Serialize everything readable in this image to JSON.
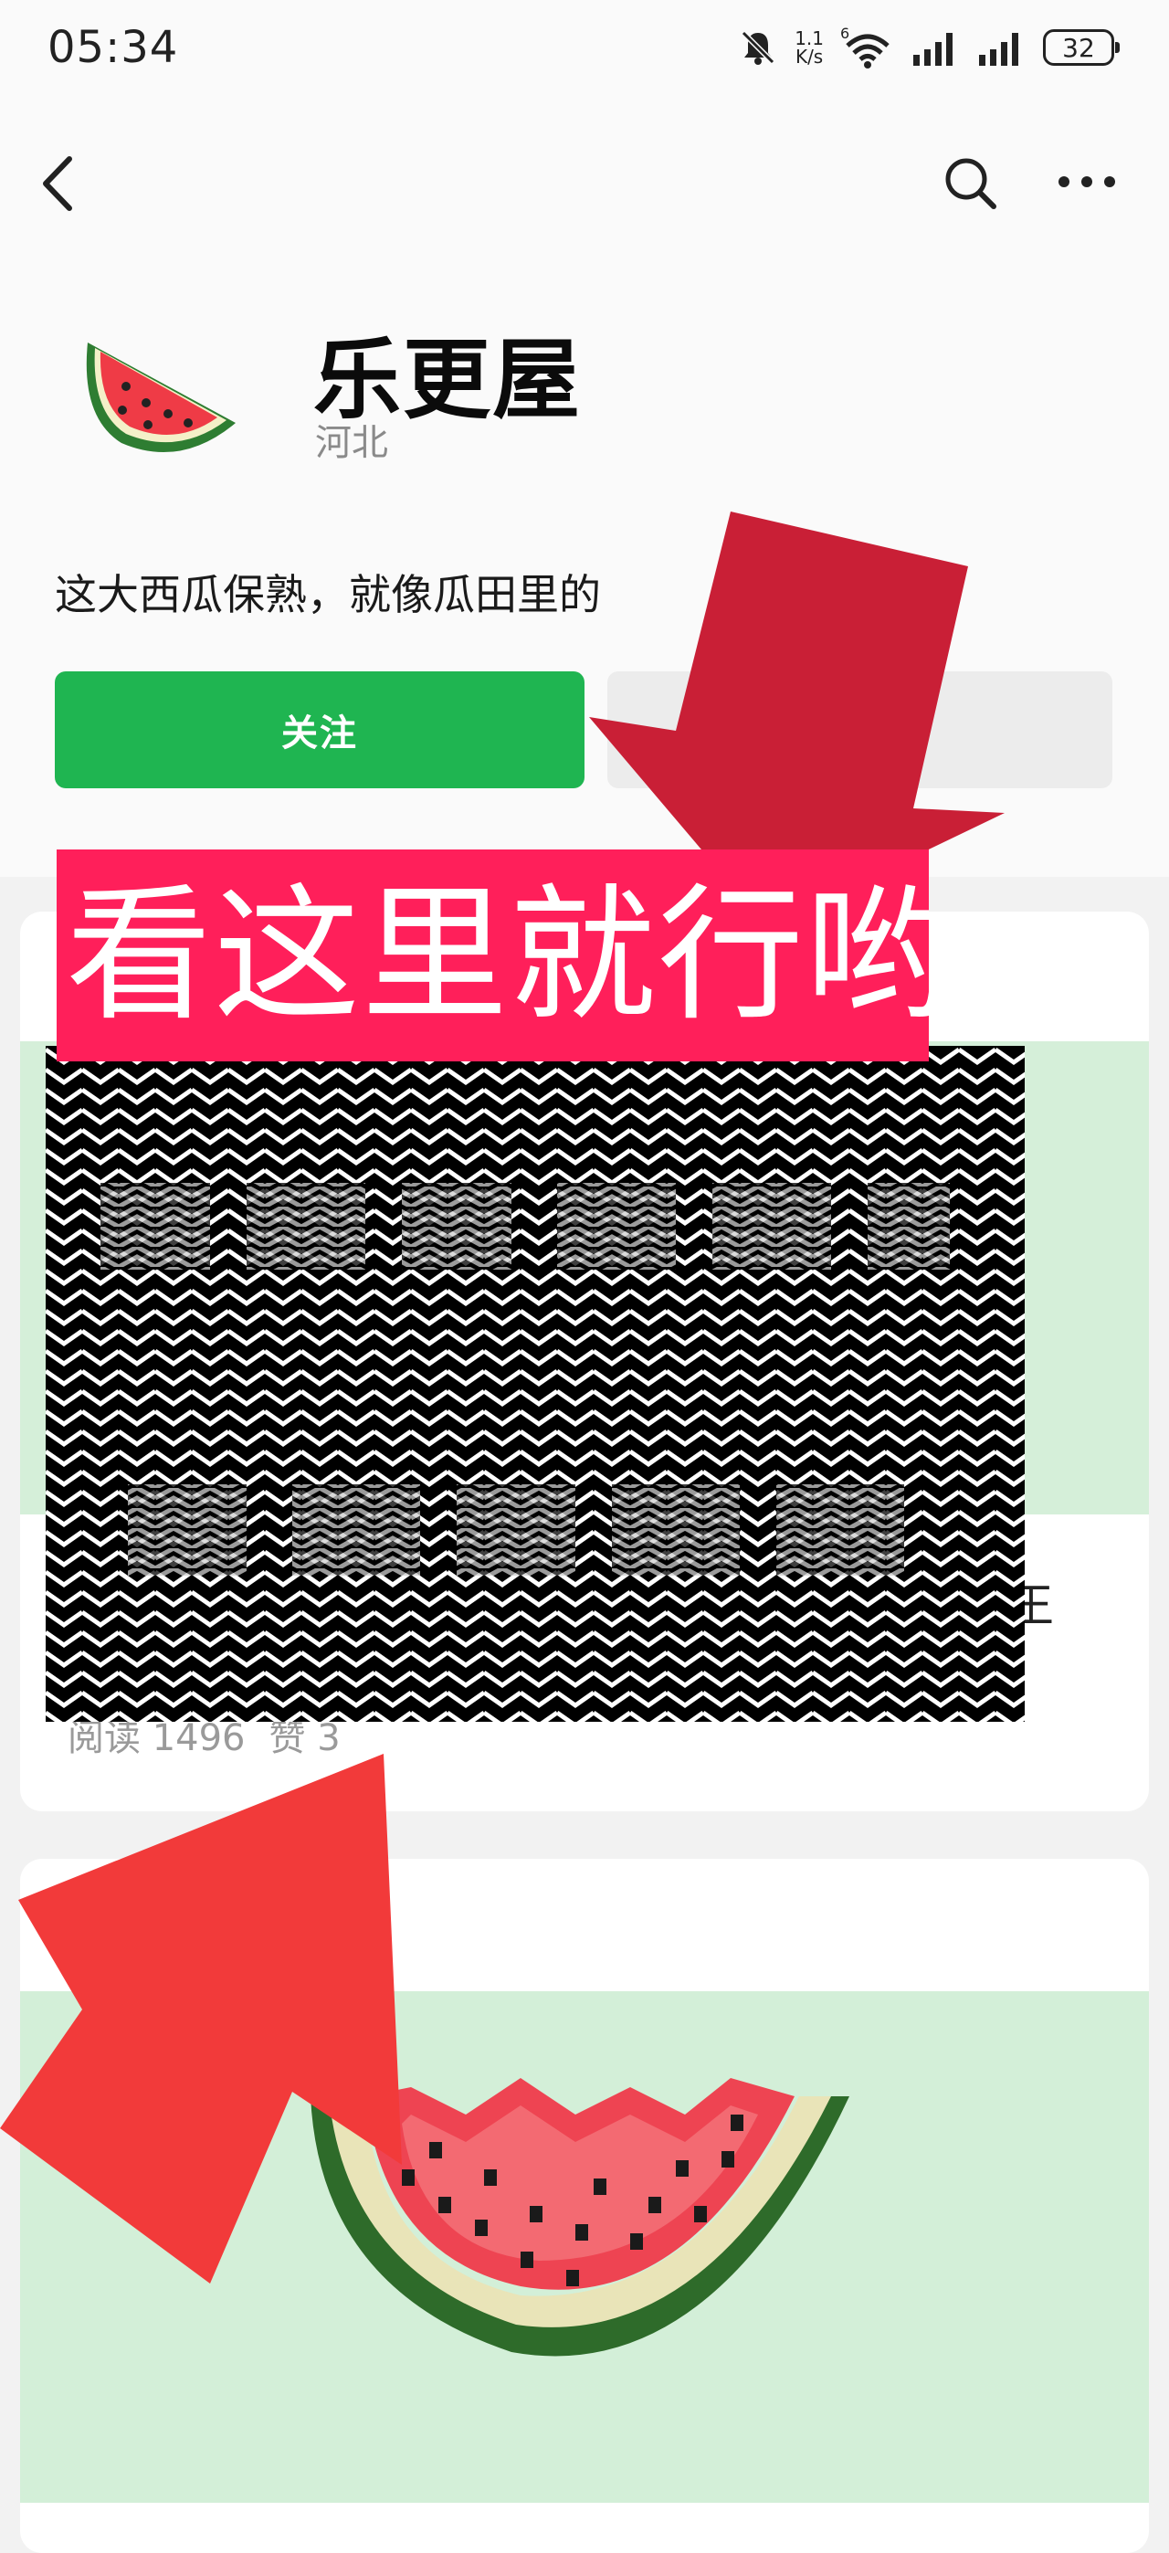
{
  "status_bar": {
    "time": "05:34",
    "net_speed_value": "1.1",
    "net_speed_unit": "K/s",
    "signal_type": "6",
    "battery": "32",
    "icons": [
      "mute-bell-icon",
      "wifi-icon",
      "signal-bars-icon",
      "signal-bars-icon",
      "battery-icon"
    ]
  },
  "nav": {
    "icons": [
      "back-chevron-icon",
      "search-icon",
      "more-dots-icon"
    ]
  },
  "profile": {
    "name": "乐更屋",
    "location": "河北",
    "bio": "这大西瓜保熟，就像瓜田里的",
    "avatar": "watermelon-slice-icon"
  },
  "actions": {
    "follow_label": "关注"
  },
  "overlay": {
    "banner_text": "看这里就行哟",
    "banner_color": "#ff1f5a",
    "arrow_color_top": "#c91f36",
    "arrow_color_bottom": "#f23a3a"
  },
  "posts": [
    {
      "title_visible": "王",
      "reads": "阅读 1496",
      "likes": "赞 3"
    },
    {
      "thumbnail": "watermelon-slice-icon"
    }
  ],
  "colors": {
    "follow_green": "#1fb551",
    "thumbnail_green": "#d5efd9"
  }
}
